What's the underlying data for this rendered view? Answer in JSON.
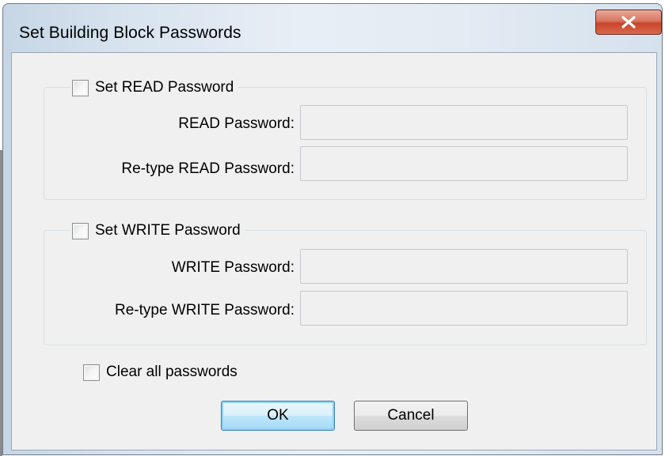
{
  "window": {
    "title": "Set Building Block Passwords",
    "close_glyph": "X"
  },
  "read_group": {
    "checkbox_label": "Set READ Password",
    "checked": false,
    "password_label": "READ Password:",
    "password_value": "",
    "retype_label": "Re-type READ Password:",
    "retype_value": ""
  },
  "write_group": {
    "checkbox_label": "Set WRITE Password",
    "checked": false,
    "password_label": "WRITE Password:",
    "password_value": "",
    "retype_label": "Re-type WRITE Password:",
    "retype_value": ""
  },
  "clear_all": {
    "label": "Clear all passwords",
    "checked": false
  },
  "buttons": {
    "ok": "OK",
    "cancel": "Cancel"
  },
  "colors": {
    "dialog_background": "#f0f0f0",
    "close_button_red": "#c7452a",
    "default_button_blue": "#3c7fb1"
  }
}
